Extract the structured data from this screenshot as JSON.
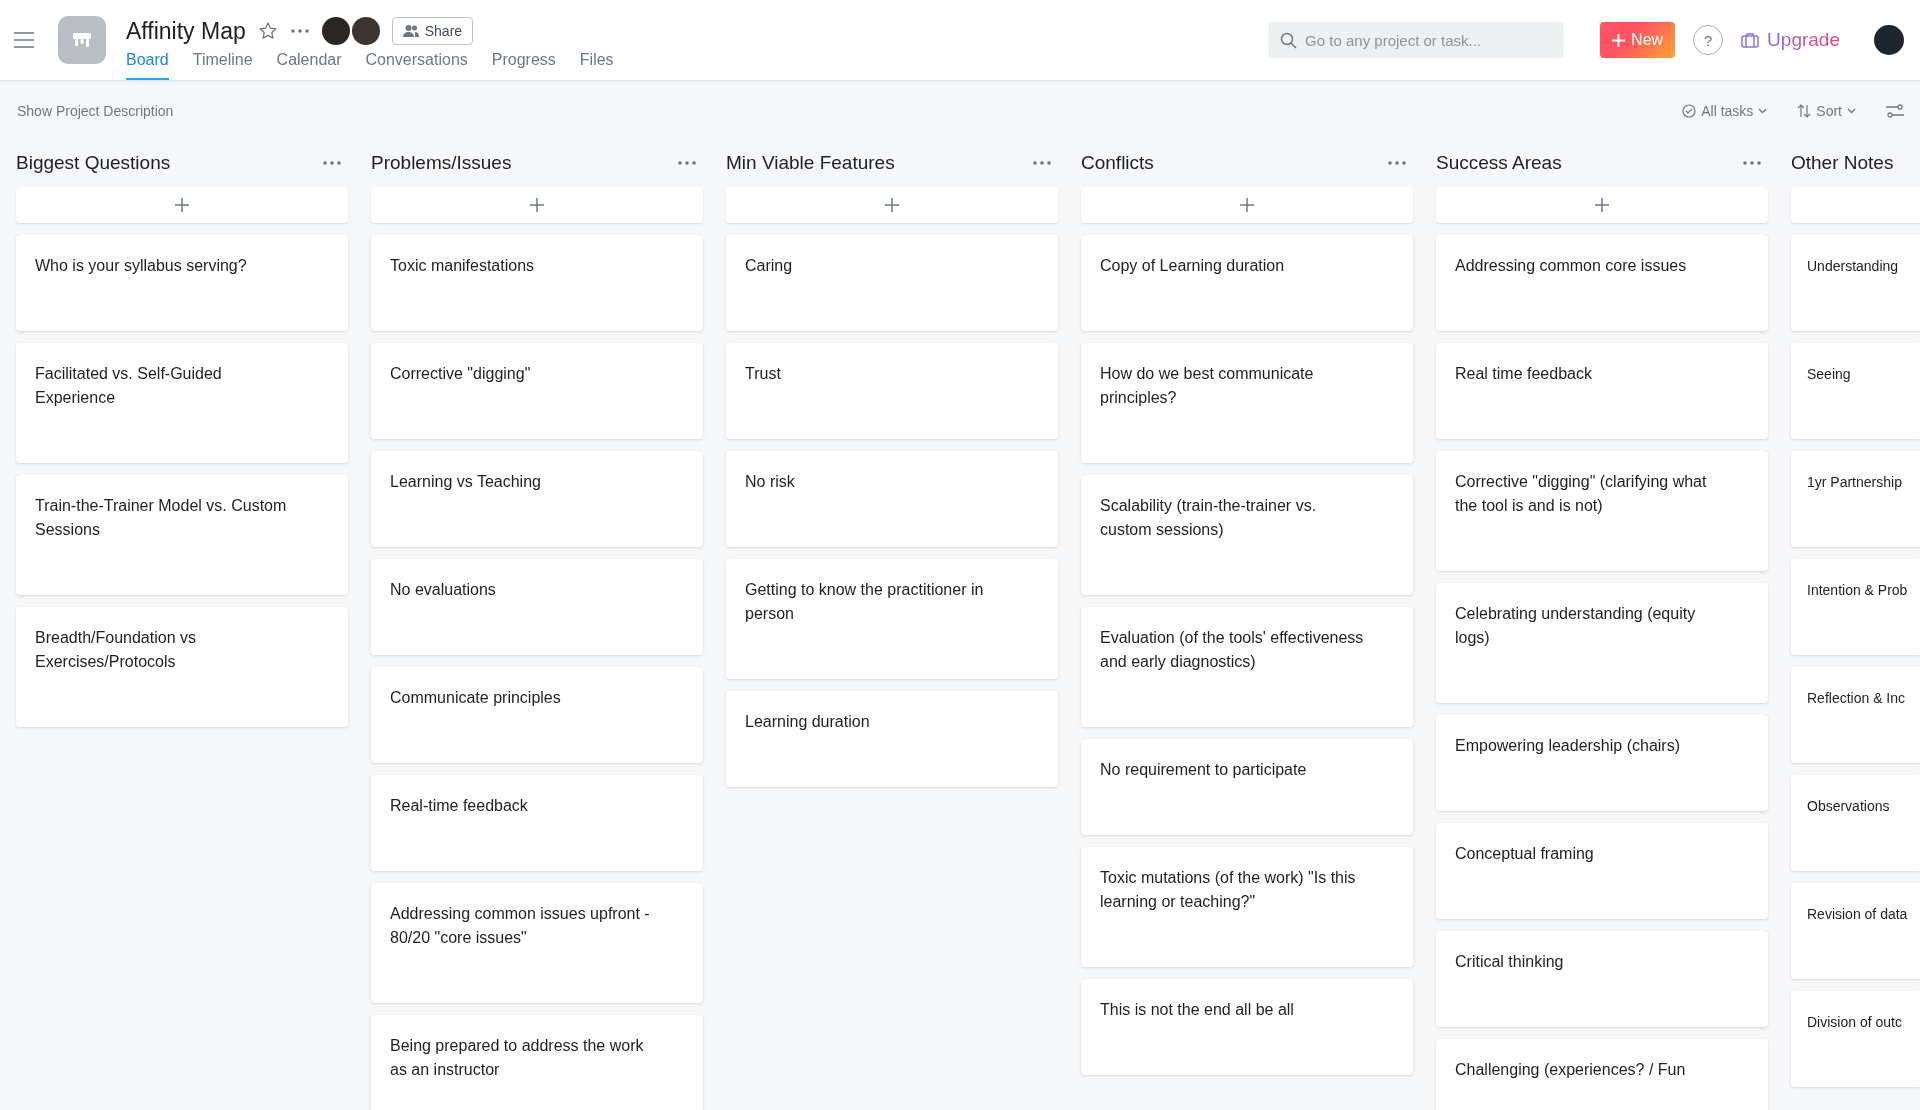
{
  "header": {
    "title": "Affinity Map",
    "share_label": "Share",
    "search": {
      "placeholder": "Go to any project or task..."
    },
    "new_label": "New",
    "help_label": "?",
    "upgrade_label": "Upgrade"
  },
  "tabs": [
    {
      "label": "Board",
      "selected": true
    },
    {
      "label": "Timeline",
      "selected": false
    },
    {
      "label": "Calendar",
      "selected": false
    },
    {
      "label": "Conversations",
      "selected": false
    },
    {
      "label": "Progress",
      "selected": false
    },
    {
      "label": "Files",
      "selected": false
    }
  ],
  "toolbar": {
    "description_link": "Show Project Description",
    "filter_label": "All tasks",
    "sort_label": "Sort"
  },
  "columns": [
    {
      "title": "Biggest Questions",
      "cards": [
        "Who is your syllabus serving?",
        "Facilitated vs. Self-Guided Experience",
        "Train-the-Trainer Model vs. Custom Sessions",
        "Breadth/Foundation vs Exercises/Protocols"
      ]
    },
    {
      "title": "Problems/Issues",
      "cards": [
        "Toxic manifestations",
        "Corrective \"digging\"",
        "Learning vs Teaching",
        "No evaluations",
        "Communicate principles",
        "Real-time feedback",
        "Addressing common issues upfront - 80/20 \"core issues\"",
        "Being prepared to address the work as an instructor"
      ]
    },
    {
      "title": "Min Viable Features",
      "cards": [
        "Caring",
        "Trust",
        "No risk",
        "Getting to know the practitioner in person",
        "Learning duration"
      ]
    },
    {
      "title": "Conflicts",
      "cards": [
        "Copy of Learning duration",
        "How do we best communicate principles?",
        "Scalability (train-the-trainer vs. custom sessions)",
        "Evaluation (of the tools' effectiveness and early diagnostics)",
        "No requirement to participate",
        "Toxic mutations (of the work) \"Is this learning or teaching?\"",
        "This is not the end all be all"
      ]
    },
    {
      "title": "Success Areas",
      "cards": [
        "Addressing common core issues",
        "Real time feedback",
        "Corrective \"digging\" (clarifying what the tool is and is not)",
        "Celebrating understanding (equity logs)",
        "Empowering leadership (chairs)",
        "Conceptual framing",
        "Critical thinking",
        "Challenging (experiences? / Fun"
      ]
    },
    {
      "title": "Other Notes",
      "cards": [
        "Understanding",
        "Seeing",
        "1yr Partnership",
        "Intention & Prob",
        "Reflection & Inc",
        "Observations",
        "Revision of data",
        "Division of outc"
      ]
    }
  ]
}
